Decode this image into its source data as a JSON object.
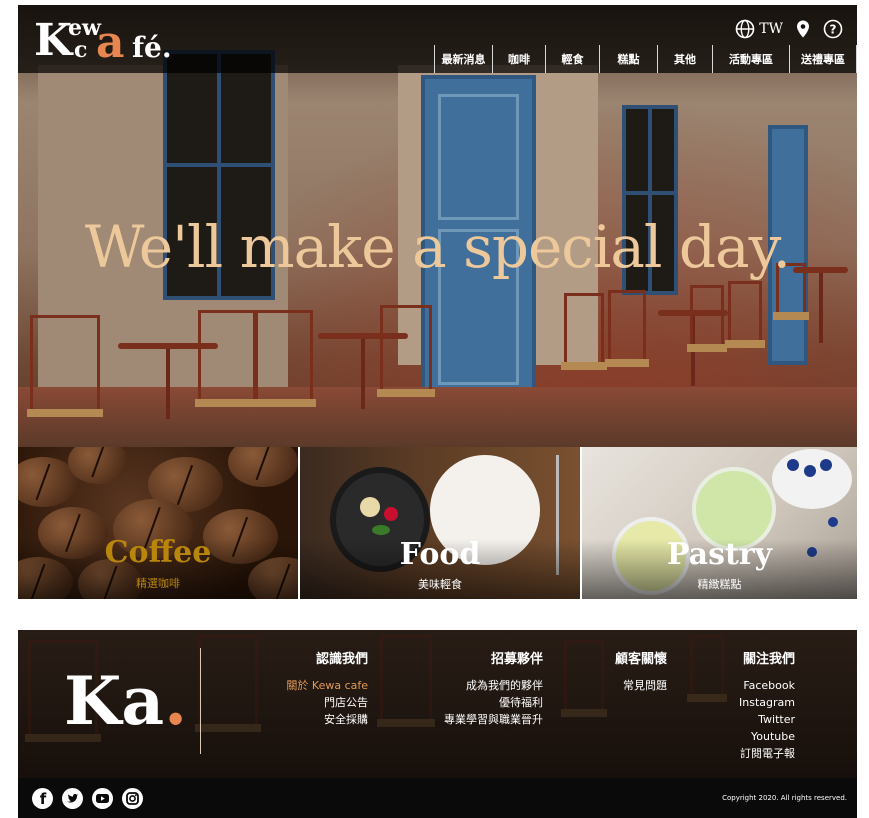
{
  "brand": {
    "logo_k": "K",
    "logo_ew": "ew",
    "logo_c": "c",
    "logo_a": "a",
    "logo_fe": "fé."
  },
  "header": {
    "language": "TW",
    "nav": [
      "最新消息",
      "咖啡",
      "輕食",
      "糕點",
      "其他",
      "活動專區",
      "送禮專區"
    ]
  },
  "hero": {
    "headline": "We'll make a special day."
  },
  "tiles": [
    {
      "title": "Coffee",
      "subtitle": "精選咖啡",
      "title_color": "#b8860b"
    },
    {
      "title": "Food",
      "subtitle": "美味輕食",
      "title_color": "#ffffff"
    },
    {
      "title": "Pastry",
      "subtitle": "精緻糕點",
      "title_color": "#ffffff"
    }
  ],
  "footer": {
    "logo_k": "K",
    "logo_a": "a",
    "logo_dot": ".",
    "columns": [
      {
        "heading": "認識我們",
        "links": [
          "關於 Kewa cafe",
          "門店公告",
          "安全採購"
        ]
      },
      {
        "heading": "招募夥伴",
        "links": [
          "成為我們的夥伴",
          "優待福利",
          "專業學習與職業晉升"
        ]
      },
      {
        "heading": "顧客關懷",
        "links": [
          "常見問題"
        ]
      },
      {
        "heading": "關注我們",
        "links": [
          "Facebook",
          "Instagram",
          "Twitter",
          "Youtube",
          "訂閱電子報"
        ]
      }
    ],
    "active_link_color": "#e09a5a",
    "copyright": "Copyright 2020. All rights reserved."
  },
  "colors": {
    "accent": "#e8864f",
    "headline": "#ecc89a"
  }
}
